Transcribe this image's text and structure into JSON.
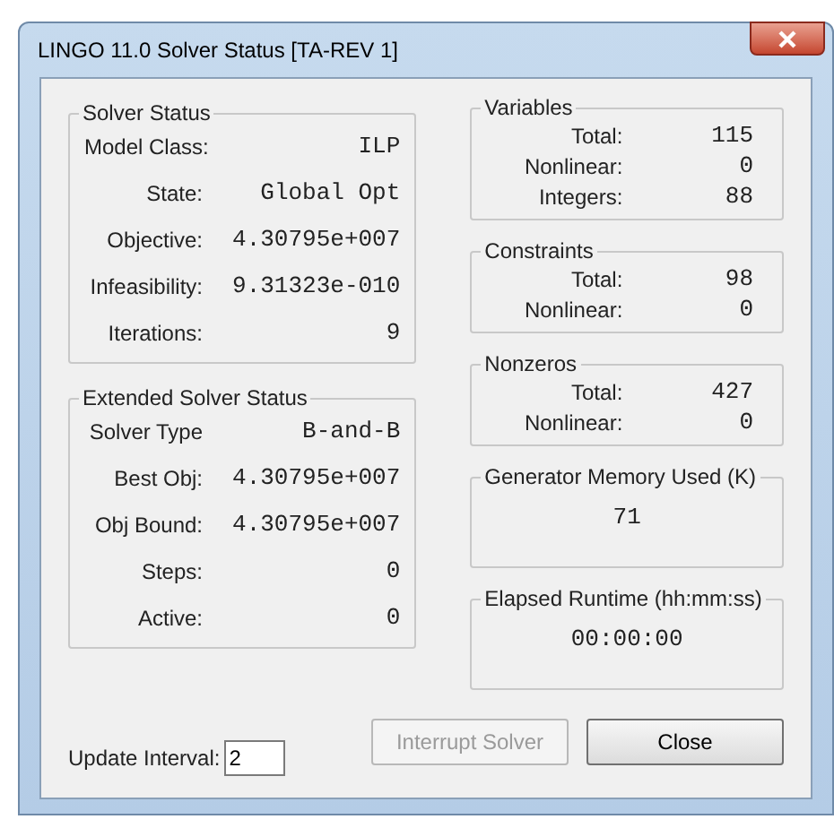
{
  "window": {
    "title": "LINGO 11.0 Solver Status [TA-REV 1]"
  },
  "solver_status": {
    "title": "Solver Status",
    "rows": [
      {
        "label": "Model Class:",
        "value": "ILP"
      },
      {
        "label": "State:",
        "value": "Global Opt"
      },
      {
        "label": "Objective:",
        "value": "4.30795e+007"
      },
      {
        "label": "Infeasibility:",
        "value": "9.31323e-010"
      },
      {
        "label": "Iterations:",
        "value": "9"
      }
    ]
  },
  "extended_solver_status": {
    "title": "Extended Solver Status",
    "rows": [
      {
        "label": "Solver Type",
        "value": "B-and-B"
      },
      {
        "label": "Best Obj:",
        "value": "4.30795e+007"
      },
      {
        "label": "Obj Bound:",
        "value": "4.30795e+007"
      },
      {
        "label": "Steps:",
        "value": "0"
      },
      {
        "label": "Active:",
        "value": "0"
      }
    ]
  },
  "counts": [
    {
      "title": "Variables",
      "rows": [
        {
          "label": "Total:",
          "value": "115"
        },
        {
          "label": "Nonlinear:",
          "value": "0"
        },
        {
          "label": "Integers:",
          "value": "88"
        }
      ]
    },
    {
      "title": "Constraints",
      "rows": [
        {
          "label": "Total:",
          "value": "98"
        },
        {
          "label": "Nonlinear:",
          "value": "0"
        }
      ]
    },
    {
      "title": "Nonzeros",
      "rows": [
        {
          "label": "Total:",
          "value": "427"
        },
        {
          "label": "Nonlinear:",
          "value": "0"
        }
      ]
    }
  ],
  "generator_memory": {
    "title": "Generator Memory Used (K)",
    "value": "71"
  },
  "elapsed_runtime": {
    "title": "Elapsed Runtime (hh:mm:ss)",
    "value": "00:00:00"
  },
  "update_interval": {
    "label": "Update Interval:",
    "value": "2"
  },
  "buttons": [
    {
      "label": "Interrupt Solver",
      "disabled": true
    },
    {
      "label": "Close",
      "disabled": false
    }
  ]
}
